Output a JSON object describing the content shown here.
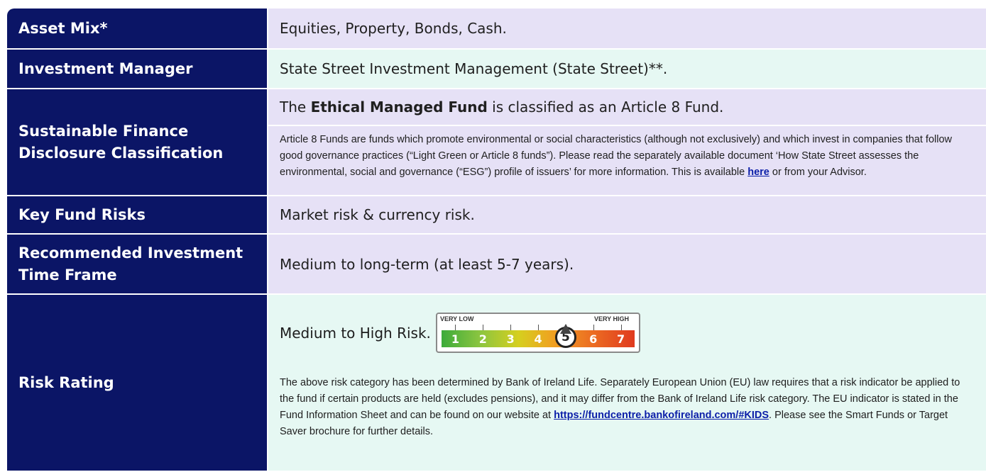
{
  "rows": {
    "asset_mix": {
      "label": "Asset Mix*",
      "value": "Equities, Property, Bonds, Cash."
    },
    "investment_manager": {
      "label": "Investment Manager",
      "value": "State Street Investment Management (State Street)**."
    },
    "sfdr": {
      "label": "Sustainable Finance Disclosure Classification",
      "line_prefix": "The ",
      "line_bold": "Ethical Managed Fund",
      "line_suffix": " is classified as an Article 8 Fund.",
      "note_text": "Article 8 Funds are funds which promote environmental or social characteristics (although not exclusively) and which invest in companies that follow good governance practices (“Light Green or Article 8 funds”). Please read the separately available document ‘How State Street assesses the environmental, social and governance (“ESG”) profile of issuers’ for more information. This is available ",
      "note_link": "here",
      "note_suffix": " or from your Advisor."
    },
    "key_risks": {
      "label": "Key Fund Risks",
      "value": "Market risk & currency risk."
    },
    "time_frame": {
      "label": "Recommended Investment Time Frame",
      "value": "Medium to long-term (at least 5-7 years)."
    },
    "risk_rating": {
      "label": "Risk Rating",
      "value": "Medium to High Risk.",
      "scale_low": "VERY LOW",
      "scale_high": "VERY HIGH",
      "scale_values": [
        "1",
        "2",
        "3",
        "4",
        "5",
        "6",
        "7"
      ],
      "selected": 5,
      "note_text": "The above risk category has been determined by Bank of Ireland Life. Separately European Union (EU) law requires that a risk indicator be applied to the fund if certain products are held (excludes pensions), and it may differ from the Bank of Ireland Life risk category. The EU indicator is stated in the Fund Information Sheet and can be found on our website at ",
      "note_link": "https://fundcentre.bankofireland.com/#KIDS",
      "note_suffix": ". Please see the Smart Funds or Target Saver brochure for further details."
    }
  },
  "colors": {
    "label_bg": "#0b1566",
    "purple_bg": "#e6e1f6",
    "green_bg": "#e6f8f3",
    "link": "#0b1ea8"
  }
}
